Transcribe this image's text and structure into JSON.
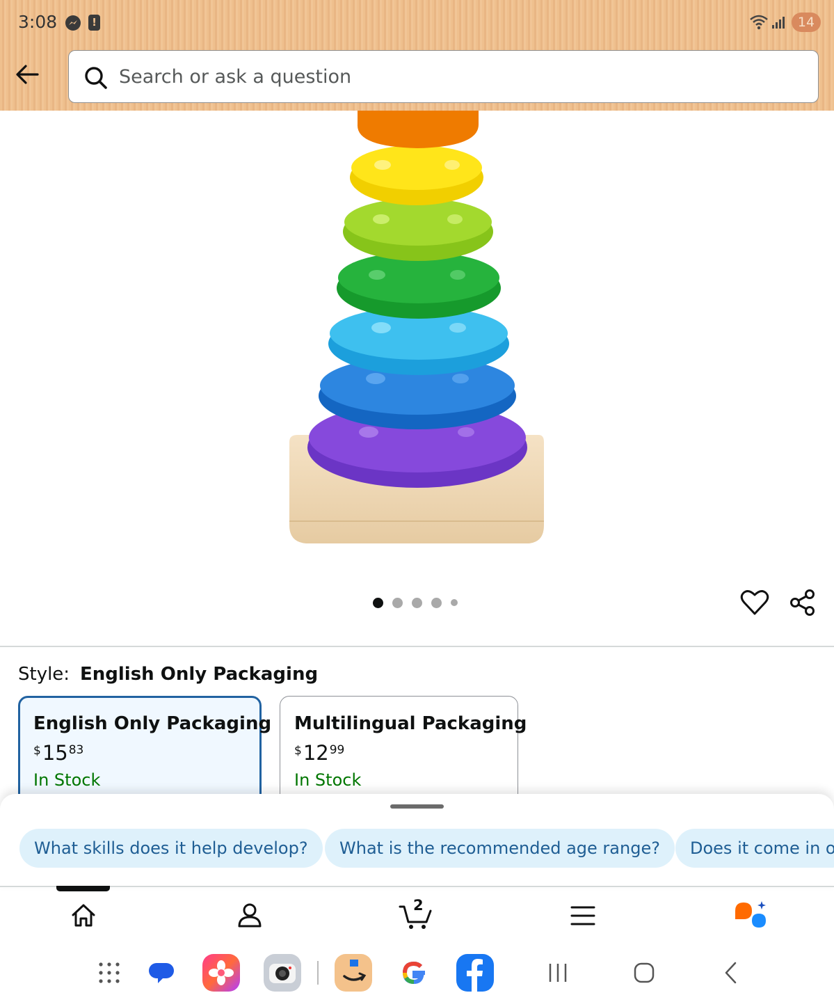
{
  "status_bar": {
    "time": "3:08",
    "battery": "14",
    "icons": [
      "messenger-icon",
      "alert-icon",
      "wifi-icon",
      "signal-icon"
    ]
  },
  "header": {
    "back_icon": "arrow-left-icon",
    "search": {
      "placeholder": "Search or ask a question",
      "value": "",
      "icon": "search-icon"
    }
  },
  "product": {
    "image": "rainbow-stacking-rings-toy",
    "carousel_total": 5,
    "carousel_active": 1,
    "actions": [
      "heart-icon",
      "share-icon"
    ]
  },
  "style_selector": {
    "label": "Style:",
    "selected_value": "English Only Packaging",
    "options": [
      {
        "name": "English Only Packaging",
        "currency": "$",
        "price_whole": "15",
        "price_fraction": "83",
        "availability": "In Stock",
        "selected": true
      },
      {
        "name": "Multilingual Packaging",
        "currency": "$",
        "price_whole": "12",
        "price_fraction": "99",
        "availability": "In Stock",
        "selected": false
      }
    ]
  },
  "suggestions": {
    "chips": [
      "What skills does it help develop?",
      "What is the recommended age range?",
      "Does it come in o"
    ]
  },
  "bottom_nav": {
    "items": [
      "home-icon",
      "account-icon",
      "cart-icon",
      "menu-icon",
      "rufus-icon"
    ],
    "cart_count": "2",
    "active": "home-icon"
  },
  "system_bar": {
    "apps": [
      "app-drawer-icon",
      "messages-app-icon",
      "gallery-app-icon",
      "camera-app-icon",
      "amazon-app-icon",
      "google-app-icon",
      "facebook-app-icon"
    ],
    "nav": [
      "recents-icon",
      "home-button-icon",
      "back-button-icon"
    ]
  },
  "colors": {
    "header_bg": "#efc08e",
    "selected_border": "#2162a1",
    "in_stock": "#007600",
    "chip_bg": "#def1fb",
    "chip_text": "#1f5e94"
  }
}
